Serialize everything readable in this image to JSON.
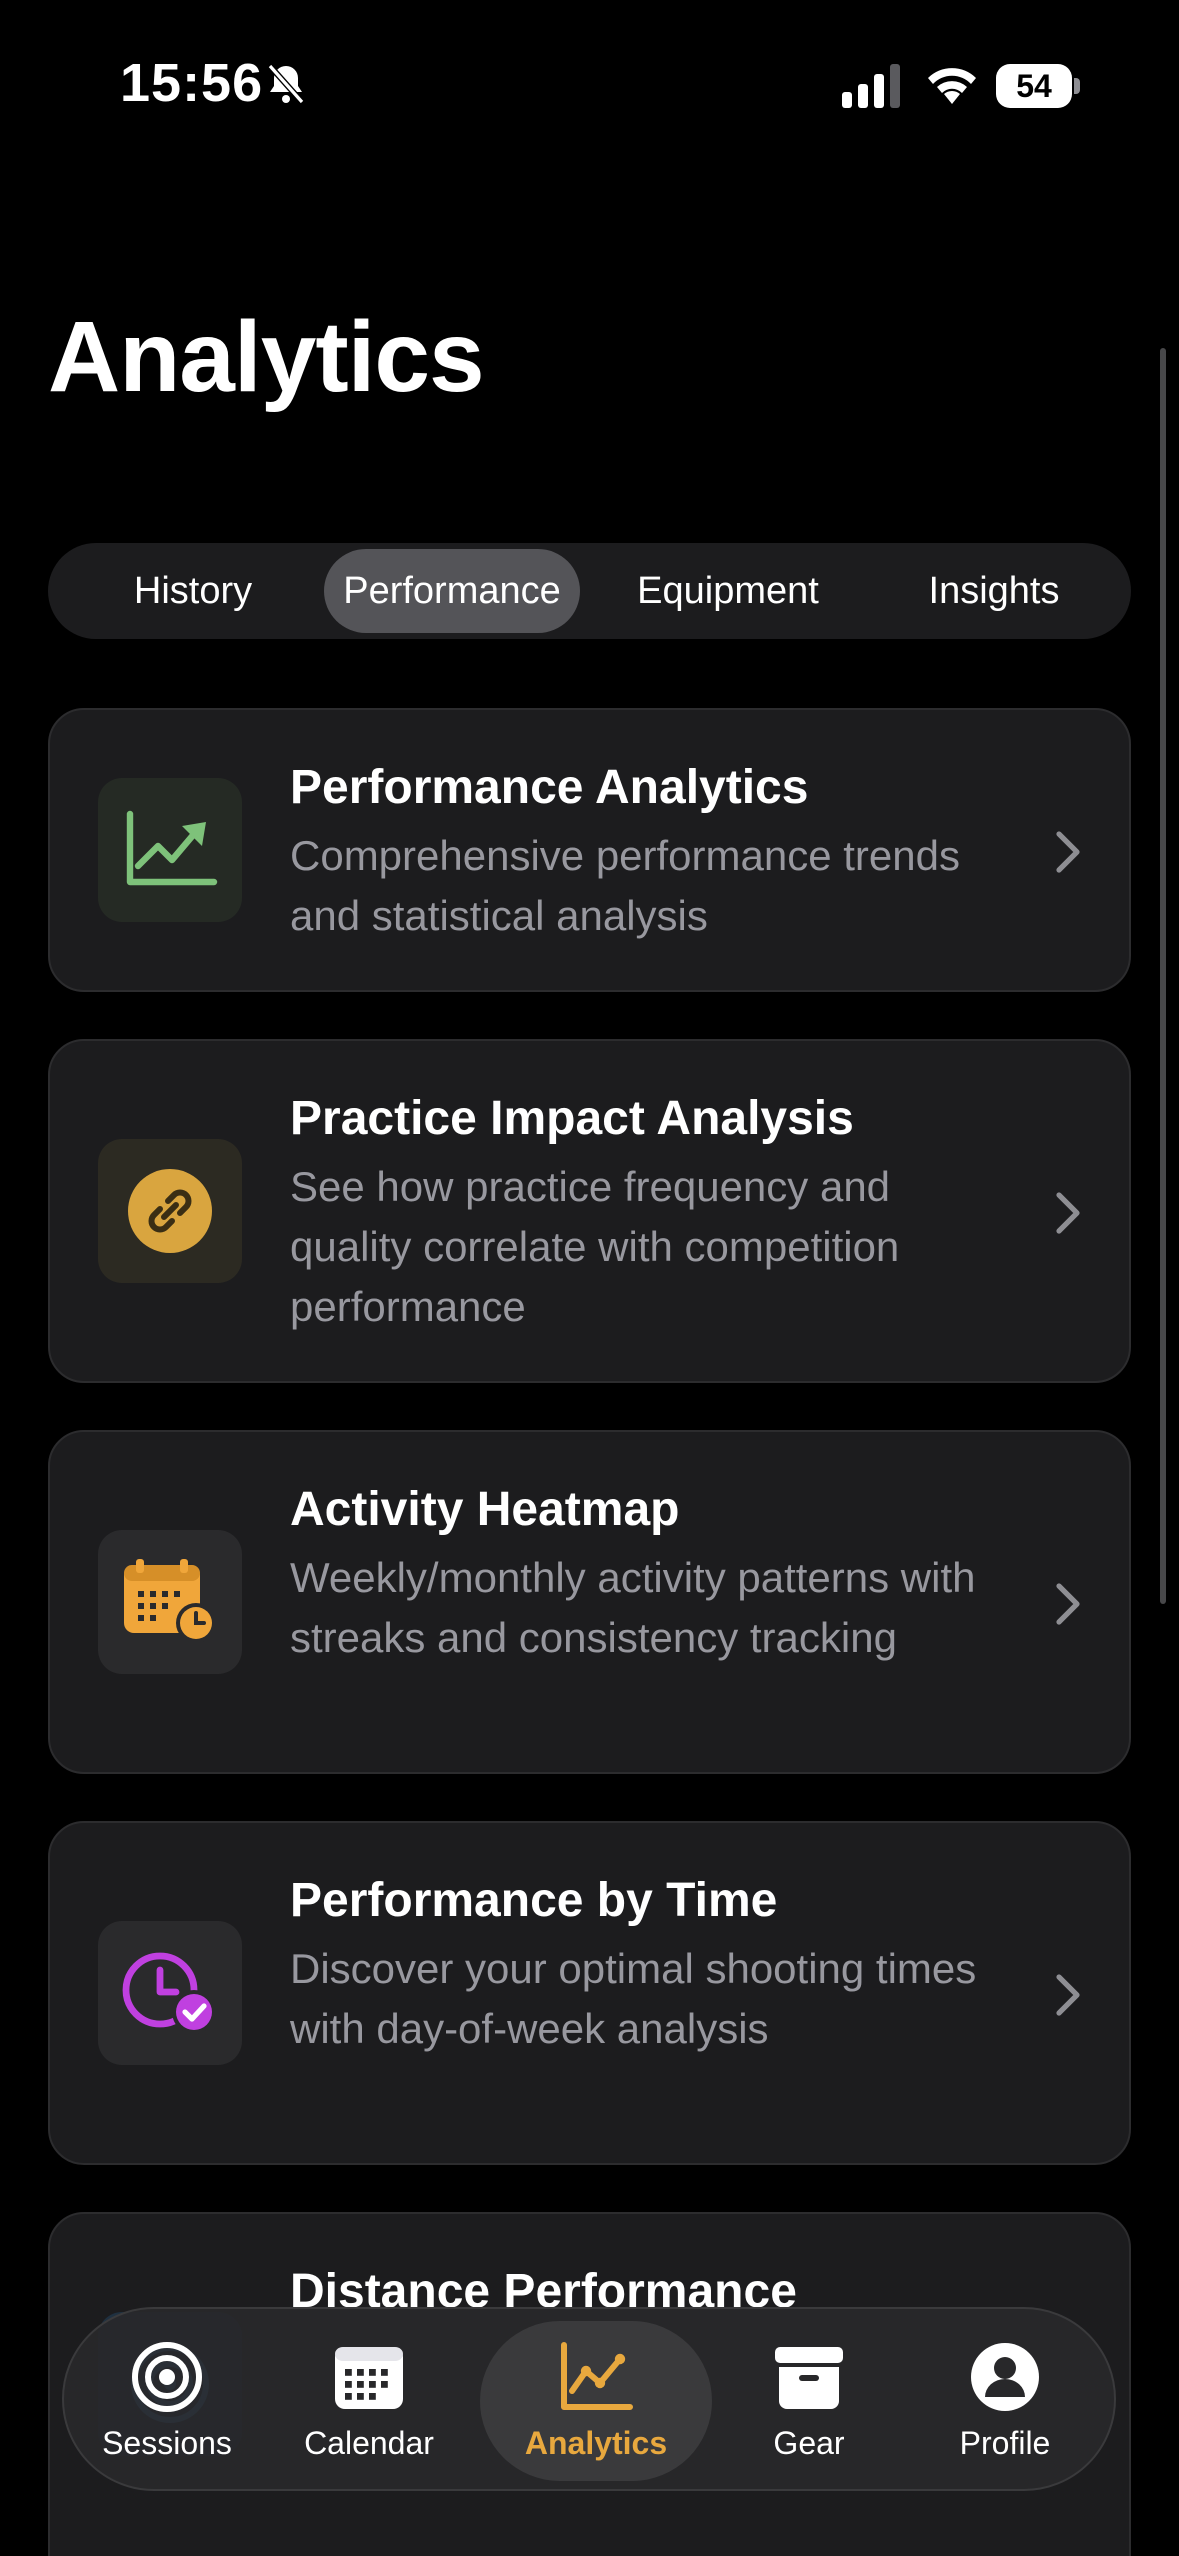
{
  "status_bar": {
    "time": "15:56",
    "battery": "54"
  },
  "page": {
    "title": "Analytics"
  },
  "segments": [
    "History",
    "Performance",
    "Equipment",
    "Insights"
  ],
  "active_segment": "Performance",
  "cards": [
    {
      "title": "Performance Analytics",
      "description": "Comprehensive performance trends and statistical analysis",
      "icon": "trend-chart-icon",
      "color": "#7ec27a"
    },
    {
      "title": "Practice Impact Analysis",
      "description": "See how practice frequency and quality correlate with competition performance",
      "icon": "link-icon",
      "color": "#d9a53f"
    },
    {
      "title": "Activity Heatmap",
      "description": "Weekly/monthly activity patterns with streaks and consistency tracking",
      "icon": "calendar-clock-icon",
      "color": "#f0a63a"
    },
    {
      "title": "Performance by Time",
      "description": "Discover your optimal shooting times with day-of-week analysis",
      "icon": "clock-check-icon",
      "color": "#c040e0"
    },
    {
      "title": "Distance Performance",
      "icon": "target-icon"
    }
  ],
  "tab_bar": [
    {
      "label": "Sessions",
      "icon": "target-icon"
    },
    {
      "label": "Calendar",
      "icon": "calendar-icon"
    },
    {
      "label": "Analytics",
      "icon": "chart-icon",
      "active": true
    },
    {
      "label": "Gear",
      "icon": "archive-box-icon"
    },
    {
      "label": "Profile",
      "icon": "person-icon"
    }
  ],
  "colors": {
    "accent": "#e8a83e",
    "background": "#000000",
    "card": "#1c1c1e",
    "secondary_text": "#98989f"
  }
}
